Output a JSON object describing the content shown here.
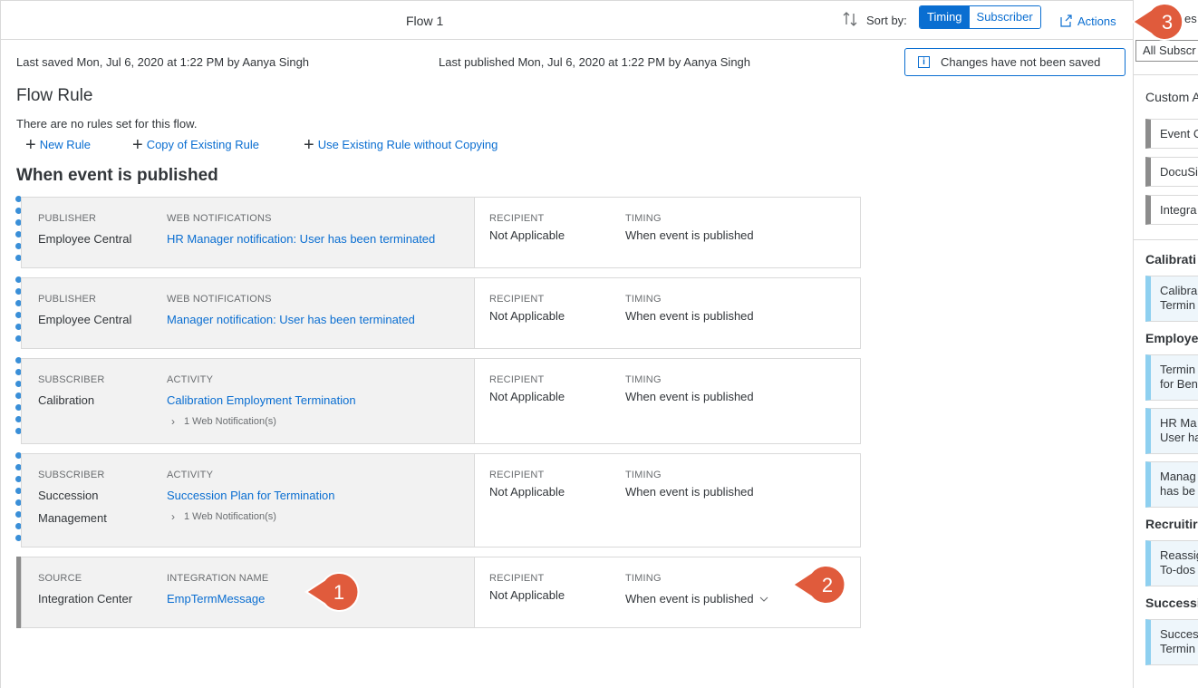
{
  "header": {
    "flow_title": "Flow 1",
    "sort_label": "Sort by:",
    "sort_options": [
      "Timing",
      "Subscriber"
    ],
    "actions_label": "Actions"
  },
  "meta": {
    "last_saved": "Last saved Mon, Jul 6, 2020 at 1:22 PM by Aanya Singh",
    "last_published": "Last published Mon, Jul 6, 2020 at 1:22 PM by Aanya Singh",
    "notice": "Changes have not been saved"
  },
  "flow_rule": {
    "title": "Flow Rule",
    "empty_text": "There are no rules set for this flow.",
    "links": [
      "New Rule",
      "Copy of Existing Rule",
      "Use Existing Rule without Copying"
    ]
  },
  "event_title": "When event is published",
  "cards": [
    {
      "label1": "PUBLISHER",
      "value1": "Employee Central",
      "label2": "WEB NOTIFICATIONS",
      "value2": "HR Manager notification: User has been terminated",
      "recipient_label": "RECIPIENT",
      "recipient": "Not Applicable",
      "timing_label": "TIMING",
      "timing": "When event is published"
    },
    {
      "label1": "PUBLISHER",
      "value1": "Employee Central",
      "label2": "WEB NOTIFICATIONS",
      "value2": "Manager notification: User has been terminated",
      "recipient_label": "RECIPIENT",
      "recipient": "Not Applicable",
      "timing_label": "TIMING",
      "timing": "When event is published"
    },
    {
      "label1": "SUBSCRIBER",
      "value1": "Calibration",
      "label2": "ACTIVITY",
      "value2": "Calibration Employment Termination",
      "sub": "1 Web Notification(s)",
      "recipient_label": "RECIPIENT",
      "recipient": "Not Applicable",
      "timing_label": "TIMING",
      "timing": "When event is published"
    },
    {
      "label1": "SUBSCRIBER",
      "value1a": "Succession",
      "value1b": "Management",
      "label2": "ACTIVITY",
      "value2": "Succession Plan for Termination",
      "sub": "1 Web Notification(s)",
      "recipient_label": "RECIPIENT",
      "recipient": "Not Applicable",
      "timing_label": "TIMING",
      "timing": "When event is published"
    },
    {
      "label1": "SOURCE",
      "value1": "Integration Center",
      "label2": "INTEGRATION NAME",
      "value2": "EmpTermMessage",
      "recipient_label": "RECIPIENT",
      "recipient": "Not Applicable",
      "timing_label": "TIMING",
      "timing": "When event is published"
    }
  ],
  "callouts": [
    "1",
    "2",
    "3"
  ],
  "right_panel": {
    "head": "es",
    "select_value": "All Subscr",
    "custom_heading": "Custom A",
    "custom_items": [
      "Event C",
      "DocuSi",
      "Integra"
    ],
    "groups": [
      {
        "title": "Calibrati",
        "items": [
          [
            "Calibra",
            "Termin"
          ]
        ]
      },
      {
        "title": "Employe",
        "items": [
          [
            "Termin",
            "for Ben"
          ],
          [
            "HR Ma",
            "User ha"
          ],
          [
            "Manag",
            "has be"
          ]
        ]
      },
      {
        "title": "Recruitir",
        "items": [
          [
            "Reassig",
            "To-dos"
          ]
        ]
      },
      {
        "title": "Successi",
        "items": [
          [
            "Succes",
            "Termin"
          ]
        ]
      }
    ]
  },
  "colors": {
    "accent": "#0a6ed1",
    "callout": "#e05b3c",
    "dot": "#3a8fd8",
    "panel_item": "#8ed0f0"
  }
}
